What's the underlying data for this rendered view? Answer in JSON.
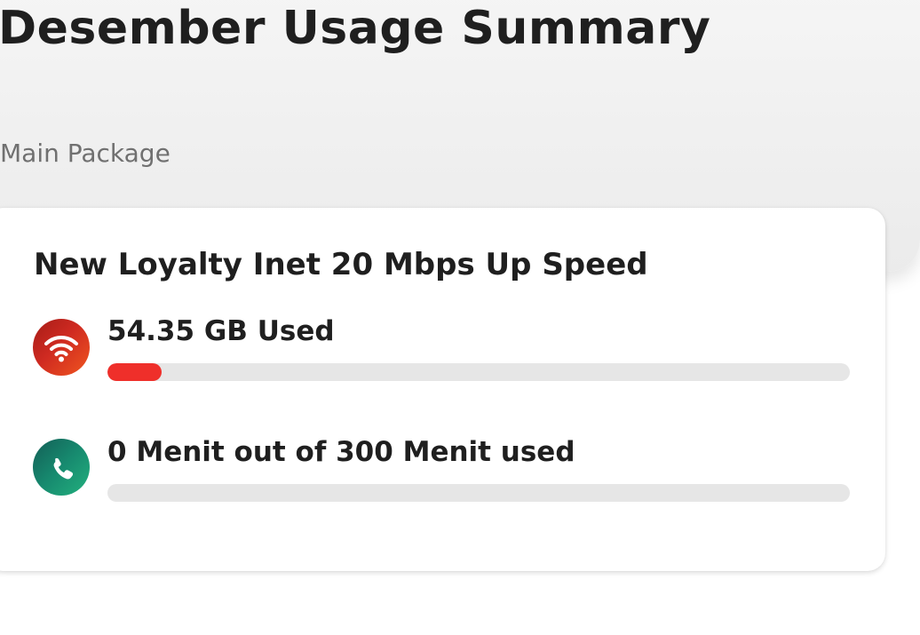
{
  "page": {
    "title": "Desember Usage Summary",
    "section_label": "Main Package"
  },
  "package": {
    "name": "New Loyalty Inet 20 Mbps Up Speed",
    "usages": [
      {
        "icon": "wifi-icon",
        "text": "54.35 GB Used",
        "progress_fraction": 0.073,
        "fill_color": "#ef2f2a",
        "icon_gradient": [
          "#a51c17",
          "#f0561f"
        ]
      },
      {
        "icon": "phone-icon",
        "text": "0 Menit out of 300 Menit used",
        "progress_fraction": 0,
        "fill_color": "#ef2f2a",
        "icon_gradient": [
          "#135e56",
          "#23b17e"
        ]
      }
    ]
  },
  "colors": {
    "track": "#e6e6e6",
    "title_text": "#1f1f1f",
    "muted_text": "#707070"
  }
}
